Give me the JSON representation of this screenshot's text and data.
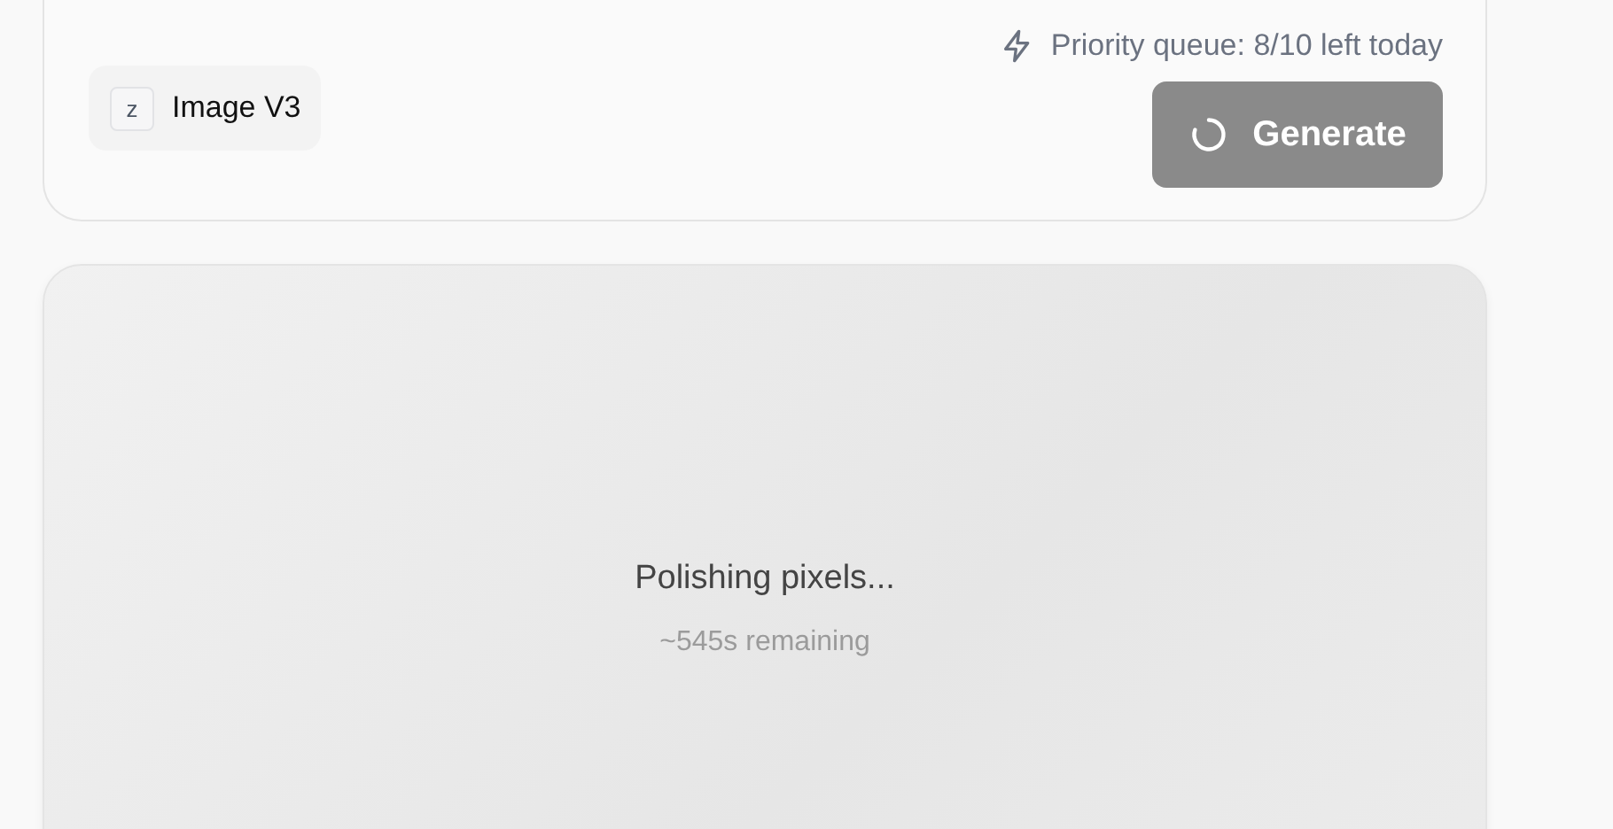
{
  "composer": {
    "model": {
      "key": "z",
      "label": "Image V3"
    },
    "queue": "Priority queue: 8/10 left today",
    "generate": {
      "label": "Generate",
      "loading": true
    }
  },
  "preview": {
    "status": "Polishing pixels...",
    "remaining": "~545s remaining"
  }
}
